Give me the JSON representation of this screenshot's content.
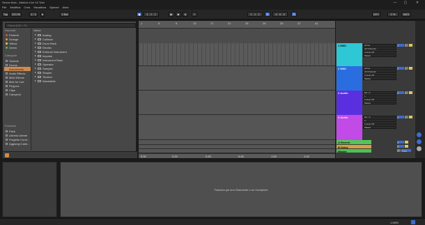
{
  "titlebar": {
    "title": "Senza titolo - Ableton Live 10 Trial",
    "min": "—",
    "max": "▢",
    "close": "✕"
  },
  "menu": [
    "File",
    "Modifica",
    "Crea",
    "Visualizza",
    "Opzioni",
    "Aiuto"
  ],
  "transport": {
    "tap": "Tap",
    "tempo": "120.00",
    "signature": "4 / 4",
    "quantize": "1 Bar",
    "position": "1 . 1 . 1",
    "loop_start": "1 . 1 . 1",
    "loop_length": "4 . 0 . 0",
    "cpu": "0 %",
    "key": "KEY",
    "midi": "MIDI"
  },
  "browser": {
    "search_placeholder": "Cerca (Ctrl + F)",
    "collections_title": "Raccolte",
    "collections": [
      {
        "label": "Preferiti",
        "color": "#e0523f"
      },
      {
        "label": "Orange",
        "color": "#e59a3c"
      },
      {
        "label": "Yellow",
        "color": "#e6d043"
      },
      {
        "label": "Green",
        "color": "#4fc05a"
      }
    ],
    "categories_title": "Categorie",
    "categories": [
      "Sounds",
      "Drums",
      "Instruments",
      "Audio Effects",
      "MIDI Effects",
      "Max for Live",
      "Plug-ins",
      "Clips",
      "Campioni"
    ],
    "selected_category": "Instruments",
    "places_title": "Posizioni",
    "places": [
      "Pack",
      "Libreria Utente",
      "Progetto Corre...",
      "Aggiungi Carte..."
    ],
    "name_header": "Nome",
    "items": [
      "Analog",
      "Collision",
      "Drum Rack",
      "Electric",
      "External Instrument",
      "Impulse",
      "Instrument Rack",
      "Operator",
      "Sampler",
      "Simpler",
      "Tension",
      "Wavetable"
    ]
  },
  "arrangement": {
    "ruler": [
      "1",
      "5",
      "9",
      "13",
      "17",
      "21",
      "25",
      "29",
      "33",
      "37",
      "41"
    ],
    "time": [
      "0:00",
      "0:15",
      "0:30",
      "0:45",
      "1:00",
      "1:15"
    ]
  },
  "tracks": [
    {
      "name": "1 MIDI",
      "color": "#2ec7d6",
      "in": "All Ins",
      "in2": "All Channels",
      "monitor": "In Auto Off",
      "out": "Master",
      "num": "1",
      "vol": "C",
      "s": "S"
    },
    {
      "name": "2 MIDI",
      "color": "#2a6de0",
      "in": "All Ins",
      "in2": "All Channels",
      "monitor": "In Auto Off",
      "out": "Master",
      "num": "2",
      "vol": "C",
      "s": "S"
    },
    {
      "name": "3 Audio",
      "color": "#5a2fe0",
      "in": "Ext. In",
      "in2": "1",
      "monitor": "In Auto Off",
      "out": "Master",
      "num": "3",
      "vol": "C",
      "s": "S"
    },
    {
      "name": "4 Audio",
      "color": "#c24ae6",
      "in": "Ext. In",
      "in2": "2",
      "monitor": "In Auto Off",
      "out": "Master",
      "num": "4",
      "vol": "C",
      "s": "S"
    }
  ],
  "returns": [
    {
      "name": "A Reverb",
      "color": "#56c45a",
      "label": "A",
      "s": "S"
    },
    {
      "name": "B Delay",
      "color": "#d6a23f",
      "label": "B",
      "s": "S"
    },
    {
      "name": "Master",
      "color": "#4fc05a",
      "label": "0",
      "s": "Solo"
    }
  ],
  "detail": {
    "hint": "Trascina qui uno Strumento o un Campione"
  },
  "status": {
    "right": "1-MIDI"
  }
}
